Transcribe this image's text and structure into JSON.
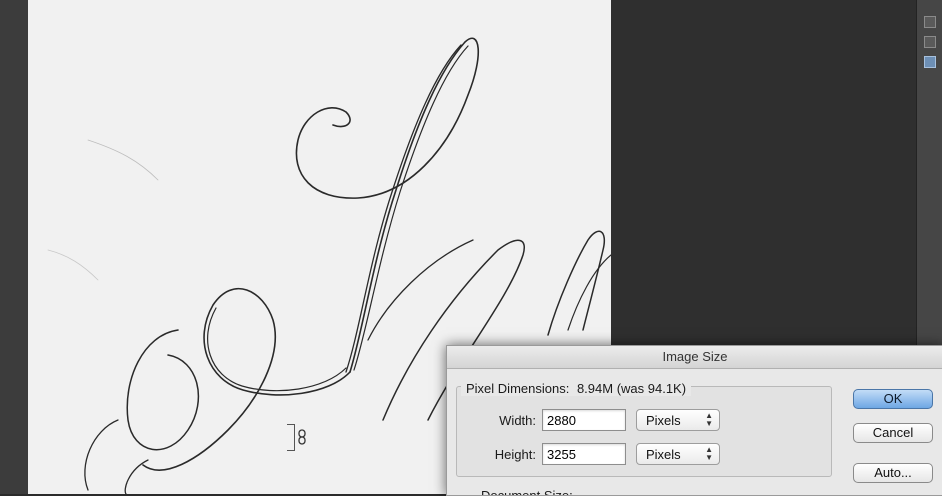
{
  "dialog": {
    "title": "Image Size",
    "pixel_dimensions": {
      "label": "Pixel Dimensions:",
      "value": "8.94M (was 94.1K)"
    },
    "width": {
      "label": "Width:",
      "value": "2880",
      "unit": "Pixels"
    },
    "height": {
      "label": "Height:",
      "value": "3255",
      "unit": "Pixels"
    },
    "buttons": {
      "ok": "OK",
      "cancel": "Cancel",
      "auto": "Auto..."
    },
    "document_size_label": "Document Size:"
  },
  "colors": {
    "workspace": "#2f2f2f",
    "document_paper": "#f1f1f1",
    "ink": "#2a2a2a",
    "ok_button_top": "#c3dcf7",
    "ok_button_bottom": "#6ea7e4"
  },
  "icons": {
    "link": "chain-link-icon",
    "select_arrows": "up-down-arrows-icon"
  }
}
